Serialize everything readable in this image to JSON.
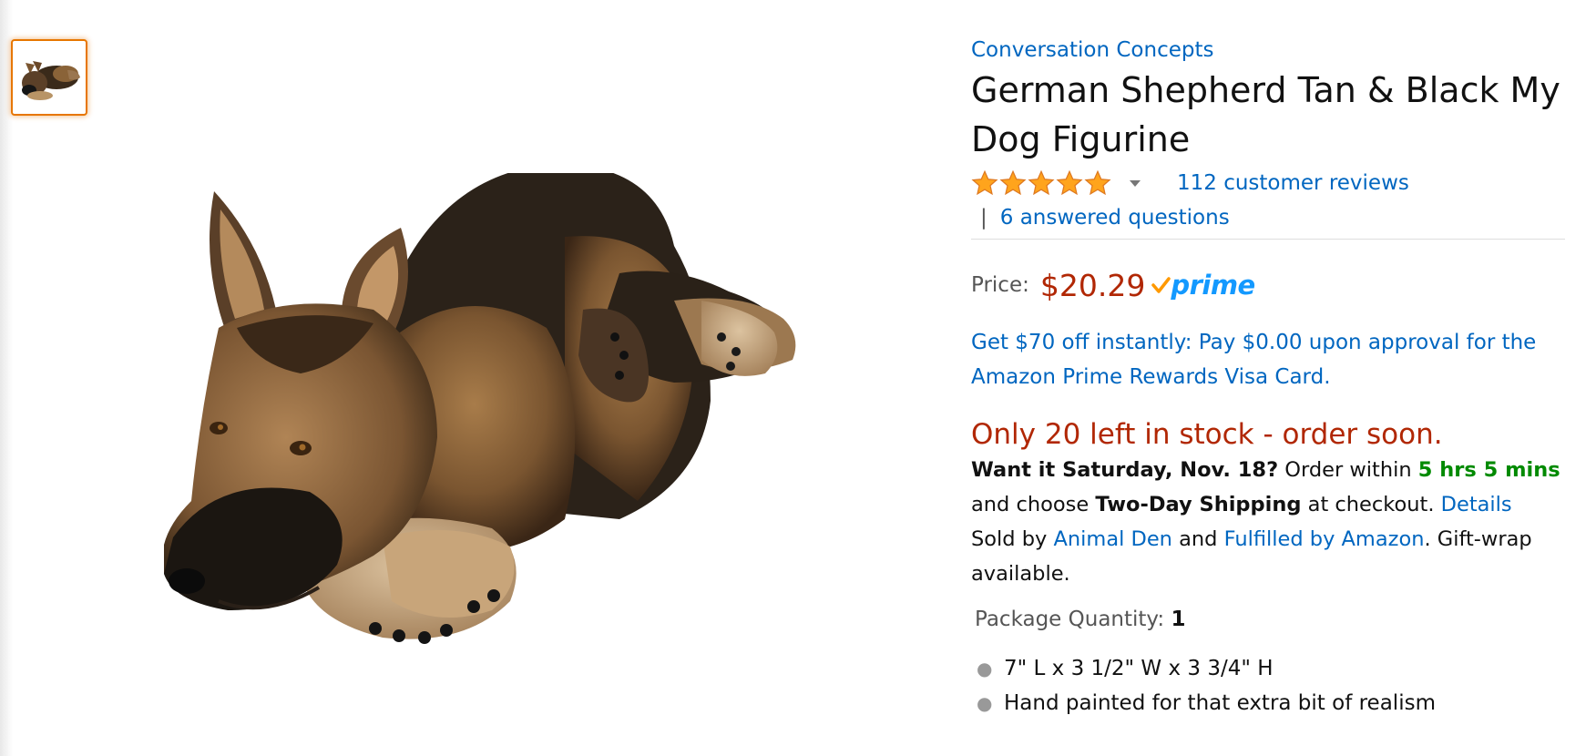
{
  "thumbnail": {
    "alt": "German Shepherd figurine thumbnail"
  },
  "product": {
    "brand": "Conversation Concepts",
    "title": "German Shepherd Tan & Black My Dog Figurine",
    "rating": {
      "stars": 5,
      "max_stars": 5,
      "reviews_label": "112 customer reviews"
    },
    "questions_label": "6 answered questions",
    "price_label": "Price:",
    "price": "$20.29",
    "prime_label": "prime",
    "promo": "Get $70 off instantly: Pay $0.00 upon approval for the Amazon Prime Rewards Visa Card.",
    "stock": "Only 20 left in stock - order soon.",
    "delivery": {
      "want_it": "Want it Saturday, Nov. 18?",
      "order_within_prefix": "Order within",
      "countdown": "5 hrs 5 mins",
      "choose_prefix": "and choose",
      "shipping_option": "Two-Day Shipping",
      "checkout_suffix": "at checkout.",
      "details_link": "Details",
      "sold_by_prefix": "Sold by",
      "seller": "Animal Den",
      "and": "and",
      "fulfilled": "Fulfilled by Amazon",
      "giftwrap": ". Gift-wrap available."
    },
    "package_quantity_label": "Package Quantity:",
    "package_quantity": "1",
    "bullets": [
      "7\" L x 3 1/2\" W x 3 3/4\" H",
      "Hand painted for that extra bit of realism"
    ]
  },
  "colors": {
    "link": "#0066c0",
    "price": "#b12704",
    "stock": "#b12704",
    "countdown": "#008a00",
    "star": "#ffa41c",
    "thumb_border": "#e77600"
  }
}
